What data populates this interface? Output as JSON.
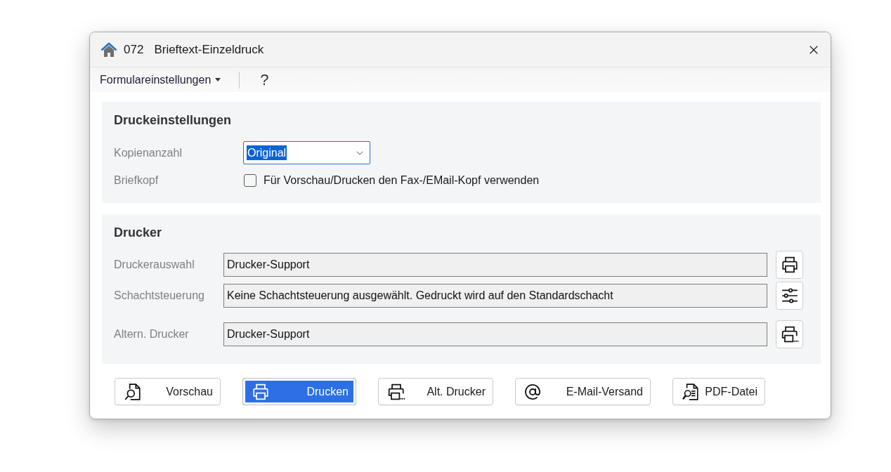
{
  "window": {
    "number": "072",
    "title": "Brieftext-Einzeldruck"
  },
  "menu": [
    {
      "label": "Formulareinstellungen",
      "kind": "dropdown"
    },
    {
      "label": "?",
      "kind": "help"
    }
  ],
  "print_settings": {
    "title": "Druckeinstellungen",
    "copies": {
      "label": "Kopienanzahl",
      "value": "Original",
      "focused": true
    },
    "letterhead": {
      "label": "Briefkopf",
      "option": "Für Vorschau/Drucken den Fax-/EMail-Kopf verwenden",
      "checked": false
    }
  },
  "printer": {
    "title": "Drucker",
    "rows": [
      {
        "label": "Druckerauswahl",
        "value": "Drucker-Support"
      },
      {
        "label": "Schachtsteuerung",
        "value": "Keine Schachtsteuerung ausgewählt. Gedruckt wird auf den Standardschacht"
      },
      {
        "label": "Altern. Drucker",
        "value": "Drucker-Support"
      }
    ]
  },
  "buttons": [
    {
      "label": "Vorschau",
      "default": false
    },
    {
      "label": "Drucken",
      "default": true
    },
    {
      "label": "Alt. Drucker",
      "default": false
    },
    {
      "label": "E-Mail-Versand",
      "default": false
    },
    {
      "label": "PDF-Datei",
      "default": false
    }
  ]
}
